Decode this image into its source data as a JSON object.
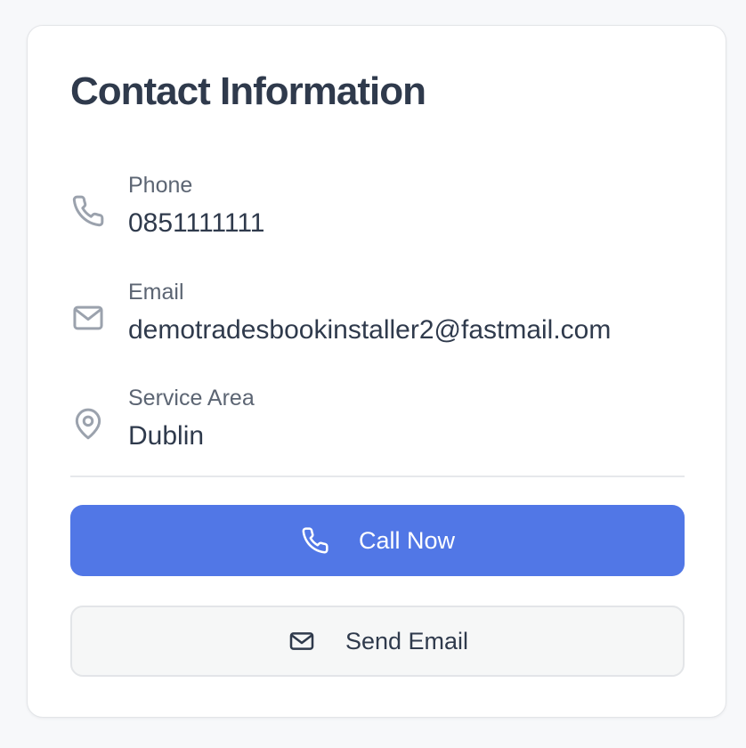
{
  "card": {
    "title": "Contact Information"
  },
  "contact": {
    "phone": {
      "label": "Phone",
      "value": "0851111111",
      "icon": "phone-icon"
    },
    "email": {
      "label": "Email",
      "value": "demotradesbookinstaller2@fastmail.com",
      "icon": "mail-icon"
    },
    "service_area": {
      "label": "Service Area",
      "value": "Dublin",
      "icon": "map-pin-icon"
    }
  },
  "actions": {
    "call": {
      "label": "Call Now",
      "icon": "phone-icon"
    },
    "email": {
      "label": "Send Email",
      "icon": "mail-icon"
    }
  },
  "colors": {
    "primary": "#5177e6",
    "text": "#2f3a4c",
    "muted_icon": "#9ba2ad"
  }
}
